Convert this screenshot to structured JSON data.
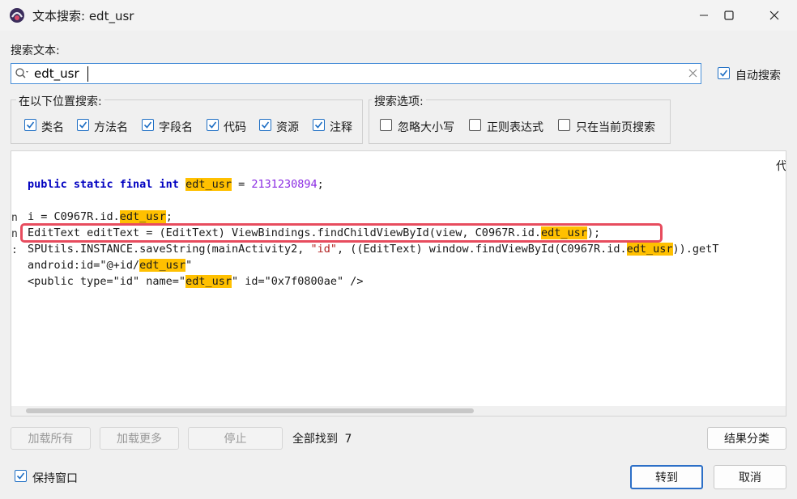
{
  "window": {
    "title": "文本搜索: edt_usr"
  },
  "search": {
    "label": "搜索文本:",
    "value": "edt_usr",
    "auto_search_label": "自动搜索",
    "auto_search_checked": true
  },
  "location_group": {
    "title": "在以下位置搜索:",
    "options": [
      {
        "label": "类名",
        "checked": true
      },
      {
        "label": "方法名",
        "checked": true
      },
      {
        "label": "字段名",
        "checked": true
      },
      {
        "label": "代码",
        "checked": true
      },
      {
        "label": "资源",
        "checked": true
      },
      {
        "label": "注释",
        "checked": true
      }
    ]
  },
  "options_group": {
    "title": "搜索选项:",
    "options": [
      {
        "label": "忽略大小写",
        "checked": false
      },
      {
        "label": "正则表达式",
        "checked": false
      },
      {
        "label": "只在当前页搜索",
        "checked": false
      }
    ]
  },
  "results": {
    "col_header_partial": "代",
    "lines": [
      {
        "prefix": "",
        "segments": [
          {
            "t": "public static final int ",
            "c": "kw"
          },
          {
            "t": "edt_usr",
            "c": "hl"
          },
          {
            "t": " = ",
            "c": ""
          },
          {
            "t": "2131230894",
            "c": "num"
          },
          {
            "t": ";",
            "c": ""
          }
        ]
      },
      {
        "prefix": "",
        "segments": [
          {
            "t": "i = C0967R.id.",
            "c": ""
          },
          {
            "t": "edt_usr",
            "c": "hl"
          },
          {
            "t": ";",
            "c": ""
          }
        ]
      },
      {
        "prefix": "",
        "segments": [
          {
            "t": "EditText editText = (EditText) ViewBindings.findChildViewById(view, C0967R.id.",
            "c": ""
          },
          {
            "t": "edt_usr",
            "c": "hl"
          },
          {
            "t": ");",
            "c": ""
          }
        ]
      },
      {
        "prefix": "",
        "segments": [
          {
            "t": "SPUtils.INSTANCE.saveString(mainActivity2, ",
            "c": ""
          },
          {
            "t": "\"id\"",
            "c": "str"
          },
          {
            "t": ", ((EditText) window.findViewById(C0967R.id.",
            "c": ""
          },
          {
            "t": "edt_usr",
            "c": "hl"
          },
          {
            "t": ")).getT",
            "c": ""
          }
        ]
      },
      {
        "prefix": "",
        "segments": [
          {
            "t": "android:id=\"@+id/",
            "c": ""
          },
          {
            "t": "edt_usr",
            "c": "hl"
          },
          {
            "t": "\"",
            "c": ""
          }
        ]
      },
      {
        "prefix": "",
        "segments": [
          {
            "t": "<public type=\"id\" name=\"",
            "c": ""
          },
          {
            "t": "edt_usr",
            "c": "hl"
          },
          {
            "t": "\" id=\"0x7f0800ae\" />",
            "c": ""
          }
        ]
      }
    ]
  },
  "footer": {
    "load_all": "加载所有",
    "load_more": "加载更多",
    "stop": "停止",
    "found_label": "全部找到",
    "found_count": "7",
    "group_results": "结果分类",
    "keep_window": "保持窗口",
    "keep_window_checked": true,
    "goto": "转到",
    "cancel": "取消"
  },
  "colors": {
    "accent": "#1f6fc4",
    "highlight": "#ffc000",
    "selection_border": "#e74c5e"
  }
}
